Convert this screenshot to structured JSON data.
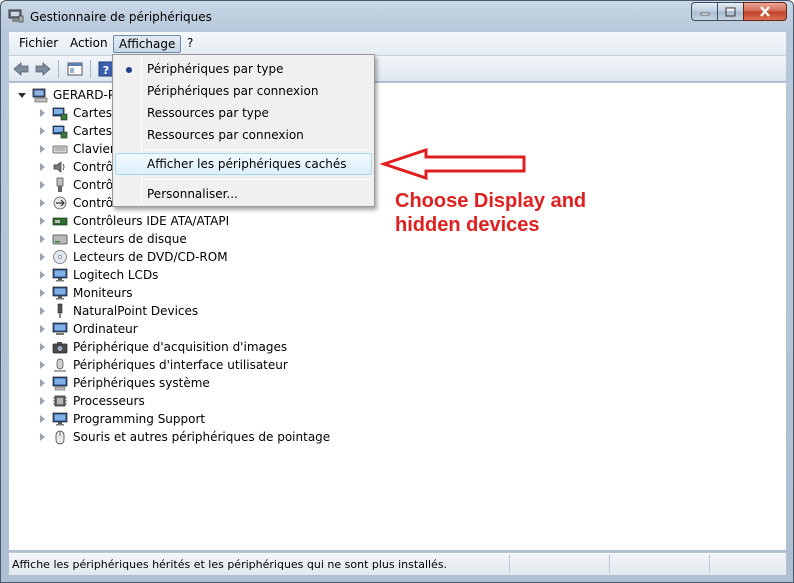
{
  "window": {
    "title": "Gestionnaire de périphériques"
  },
  "menubar": {
    "items": [
      "Fichier",
      "Action",
      "Affichage",
      "?"
    ]
  },
  "tree": {
    "root": "GERARD-PC",
    "items": [
      {
        "label": "Cartes g",
        "icon": "network-adapter-icon"
      },
      {
        "label": "Cartes r",
        "icon": "network-adapter-icon"
      },
      {
        "label": "Claviers",
        "icon": "keyboard-icon"
      },
      {
        "label": "Contrôl",
        "icon": "sound-controller-icon"
      },
      {
        "label": "Contrôl",
        "icon": "usb-controller-icon"
      },
      {
        "label": "Contrôl",
        "icon": "bus-controller-icon"
      },
      {
        "label": "Contrôleurs IDE ATA/ATAPI",
        "icon": "ide-controller-icon"
      },
      {
        "label": "Lecteurs de disque",
        "icon": "disk-drive-icon"
      },
      {
        "label": "Lecteurs de DVD/CD-ROM",
        "icon": "dvd-drive-icon"
      },
      {
        "label": "Logitech LCDs",
        "icon": "monitor-icon"
      },
      {
        "label": "Moniteurs",
        "icon": "monitor-icon"
      },
      {
        "label": "NaturalPoint Devices",
        "icon": "device-icon"
      },
      {
        "label": "Ordinateur",
        "icon": "computer-icon"
      },
      {
        "label": "Périphérique d'acquisition d'images",
        "icon": "camera-icon"
      },
      {
        "label": "Périphériques d'interface utilisateur",
        "icon": "hid-icon"
      },
      {
        "label": "Périphériques système",
        "icon": "system-device-icon"
      },
      {
        "label": "Processeurs",
        "icon": "processor-icon"
      },
      {
        "label": "Programming Support",
        "icon": "monitor-icon"
      },
      {
        "label": "Souris et autres périphériques de pointage",
        "icon": "mouse-icon"
      }
    ]
  },
  "dropdown": {
    "items": [
      "Périphériques par type",
      "Périphériques par connexion",
      "Ressources par type",
      "Ressources par connexion",
      "Afficher les périphériques cachés",
      "Personnaliser..."
    ],
    "checked_index": 0,
    "highlighted_index": 4
  },
  "annotation": {
    "line1": "Choose Display and",
    "line2": "hidden devices",
    "color": "#e02020"
  },
  "statusbar": {
    "text": "Affiche les périphériques hérités et les périphériques qui ne sont plus installés."
  }
}
